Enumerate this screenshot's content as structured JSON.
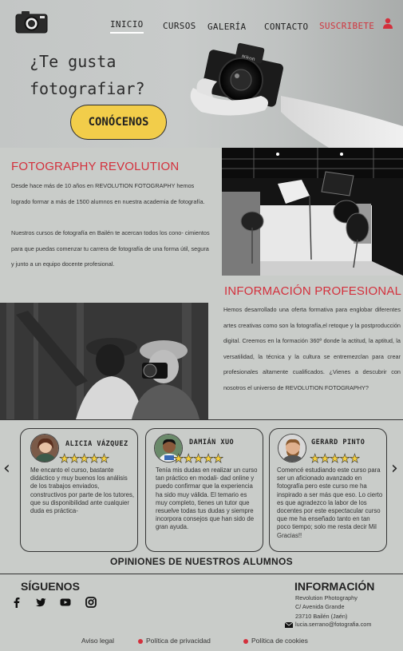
{
  "header": {
    "logo": "camera-logo",
    "nav": [
      {
        "label": "INICIO",
        "active": true
      },
      {
        "label": "CURSOS"
      },
      {
        "label": "GALERÍA"
      },
      {
        "label": "CONTACTO"
      },
      {
        "label": "SUSCRIBETE"
      }
    ],
    "user_icon": "user-icon"
  },
  "hero": {
    "title": "¿Te gusta fotografiar?",
    "button": "CONÓCENOS"
  },
  "about": {
    "title": "FOTOGRAPHY REVOLUTION",
    "p1": "Desde hace más de 10 años en REVOLUTION FOTOGRAPHY hemos logrado formar a más de 1500 alumnos en nuestra academia de fotografía.",
    "p2": "Nuestros cursos de fotografía en Bailén te acercan todos los cono- cimientos para que puedas comenzar tu carrera de fotografía de una forma útil, segura y junto a un equipo docente profesional."
  },
  "info_pro": {
    "title": "INFORMACIÓN PROFESIONAL",
    "text": "Hemos desarrollado una oferta formativa para englobar diferentes artes creativas como son la fotografía,el retoque y la postproducción digital. Creemos en la formación 360º donde la actitud, la aptitud, la versatilidad, la técnica y la cultura se entremezclan para crear profesionales altamente cualificados. ¿Vienes a descubrir con nosotros el universo de REVOLUTION FOTOGRAPHY?"
  },
  "testimonials": {
    "heading": "OPINIONES DE NUESTROS ALUMNOS",
    "stars": "★★★★★",
    "items": [
      {
        "name": "ALICIA VÁZQUEZ",
        "rating": 5,
        "text": "Me encanto el curso, bastante didáctico y muy buenos los análisis de los trabajos enviados, constructivos por parte de los tutores, que su disponibilidad ante cualquier duda es práctica-"
      },
      {
        "name": "DAMIÁN XUO",
        "rating": 5,
        "text": "Tenía mis dudas en realizar un curso tan práctico en modali- dad online y puedo confirmar que la experiencia ha sido muy válida. El temario es muy completo, tienes un tutor que resuelve todas tus dudas y siempre incorpora consejos que han sido de gran ayuda."
      },
      {
        "name": "GERARD PINTO",
        "rating": 5,
        "text": "Comencé estudiando este curso para ser un aficionado avanzado en fotografía pero este curso me ha inspirado a ser más que eso. Lo cierto es que agradezco la labor de los docentes por este espectacular curso que me ha enseñado tanto en tan poco tiempo; solo me resta decir Mil Gracias!!"
      }
    ],
    "prev": "‹",
    "next": "›"
  },
  "footer": {
    "follow": "SÍGUENOS",
    "social": [
      "facebook-icon",
      "twitter-icon",
      "youtube-icon",
      "instagram-icon"
    ],
    "info_title": "INFORMACIÓN",
    "info_lines": [
      "Revolution Photography",
      "C/ Avenida Grande",
      "23710 Bailén (Jaén)"
    ],
    "email": "lucia.serrano@fotografia.com",
    "links": [
      "Aviso legal",
      "Política de privacidad",
      "Política de cookies"
    ]
  }
}
